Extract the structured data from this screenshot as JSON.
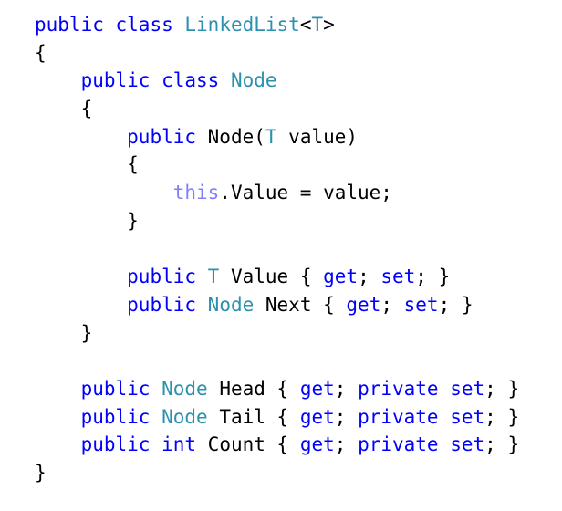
{
  "code": {
    "colors": {
      "keyword": "#0000ff",
      "type": "#2b91af",
      "this_keyword": "#8080ff",
      "plain": "#000000",
      "background": "#ffffff"
    },
    "lines": [
      {
        "indent": "",
        "tokens": [
          {
            "k": "kw",
            "t": "public"
          },
          {
            "k": "plain",
            "t": " "
          },
          {
            "k": "kw",
            "t": "class"
          },
          {
            "k": "plain",
            "t": " "
          },
          {
            "k": "type",
            "t": "LinkedList"
          },
          {
            "k": "plain",
            "t": "<"
          },
          {
            "k": "type",
            "t": "T"
          },
          {
            "k": "plain",
            "t": ">"
          }
        ]
      },
      {
        "indent": "",
        "tokens": [
          {
            "k": "plain",
            "t": "{"
          }
        ]
      },
      {
        "indent": "    ",
        "tokens": [
          {
            "k": "kw",
            "t": "public"
          },
          {
            "k": "plain",
            "t": " "
          },
          {
            "k": "kw",
            "t": "class"
          },
          {
            "k": "plain",
            "t": " "
          },
          {
            "k": "type",
            "t": "Node"
          }
        ]
      },
      {
        "indent": "    ",
        "tokens": [
          {
            "k": "plain",
            "t": "{"
          }
        ]
      },
      {
        "indent": "        ",
        "tokens": [
          {
            "k": "kw",
            "t": "public"
          },
          {
            "k": "plain",
            "t": " Node("
          },
          {
            "k": "type",
            "t": "T"
          },
          {
            "k": "plain",
            "t": " value)"
          }
        ]
      },
      {
        "indent": "        ",
        "tokens": [
          {
            "k": "plain",
            "t": "{"
          }
        ]
      },
      {
        "indent": "            ",
        "tokens": [
          {
            "k": "this",
            "t": "this"
          },
          {
            "k": "plain",
            "t": ".Value = value;"
          }
        ]
      },
      {
        "indent": "        ",
        "tokens": [
          {
            "k": "plain",
            "t": "}"
          }
        ]
      },
      {
        "indent": "",
        "tokens": []
      },
      {
        "indent": "        ",
        "tokens": [
          {
            "k": "kw",
            "t": "public"
          },
          {
            "k": "plain",
            "t": " "
          },
          {
            "k": "type",
            "t": "T"
          },
          {
            "k": "plain",
            "t": " Value { "
          },
          {
            "k": "kw",
            "t": "get"
          },
          {
            "k": "plain",
            "t": "; "
          },
          {
            "k": "kw",
            "t": "set"
          },
          {
            "k": "plain",
            "t": "; }"
          }
        ]
      },
      {
        "indent": "        ",
        "tokens": [
          {
            "k": "kw",
            "t": "public"
          },
          {
            "k": "plain",
            "t": " "
          },
          {
            "k": "type",
            "t": "Node"
          },
          {
            "k": "plain",
            "t": " Next { "
          },
          {
            "k": "kw",
            "t": "get"
          },
          {
            "k": "plain",
            "t": "; "
          },
          {
            "k": "kw",
            "t": "set"
          },
          {
            "k": "plain",
            "t": "; }"
          }
        ]
      },
      {
        "indent": "    ",
        "tokens": [
          {
            "k": "plain",
            "t": "}"
          }
        ]
      },
      {
        "indent": "",
        "tokens": []
      },
      {
        "indent": "    ",
        "tokens": [
          {
            "k": "kw",
            "t": "public"
          },
          {
            "k": "plain",
            "t": " "
          },
          {
            "k": "type",
            "t": "Node"
          },
          {
            "k": "plain",
            "t": " Head { "
          },
          {
            "k": "kw",
            "t": "get"
          },
          {
            "k": "plain",
            "t": "; "
          },
          {
            "k": "kw",
            "t": "private"
          },
          {
            "k": "plain",
            "t": " "
          },
          {
            "k": "kw",
            "t": "set"
          },
          {
            "k": "plain",
            "t": "; }"
          }
        ]
      },
      {
        "indent": "    ",
        "tokens": [
          {
            "k": "kw",
            "t": "public"
          },
          {
            "k": "plain",
            "t": " "
          },
          {
            "k": "type",
            "t": "Node"
          },
          {
            "k": "plain",
            "t": " Tail { "
          },
          {
            "k": "kw",
            "t": "get"
          },
          {
            "k": "plain",
            "t": "; "
          },
          {
            "k": "kw",
            "t": "private"
          },
          {
            "k": "plain",
            "t": " "
          },
          {
            "k": "kw",
            "t": "set"
          },
          {
            "k": "plain",
            "t": "; }"
          }
        ]
      },
      {
        "indent": "    ",
        "tokens": [
          {
            "k": "kw",
            "t": "public"
          },
          {
            "k": "plain",
            "t": " "
          },
          {
            "k": "kw",
            "t": "int"
          },
          {
            "k": "plain",
            "t": " Count { "
          },
          {
            "k": "kw",
            "t": "get"
          },
          {
            "k": "plain",
            "t": "; "
          },
          {
            "k": "kw",
            "t": "private"
          },
          {
            "k": "plain",
            "t": " "
          },
          {
            "k": "kw",
            "t": "set"
          },
          {
            "k": "plain",
            "t": "; }"
          }
        ]
      },
      {
        "indent": "",
        "tokens": [
          {
            "k": "plain",
            "t": "}"
          }
        ]
      }
    ]
  }
}
